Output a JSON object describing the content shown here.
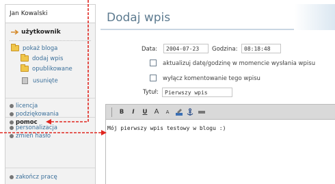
{
  "sidebar": {
    "user_name": "Jan Kowalski",
    "user_section_title": "użytkownik",
    "tree": [
      {
        "label": "pokaż bloga",
        "icon": "folder-icon"
      },
      {
        "label": "dodaj wpis",
        "icon": "folder-icon"
      },
      {
        "label": "opublikowane",
        "icon": "folder-icon"
      },
      {
        "label": "usunięte",
        "icon": "trash-icon"
      }
    ],
    "links_group1": [
      "licencja",
      "podziękowania",
      "pomoc"
    ],
    "links_group2": [
      "personalizacja",
      "zmień hasło"
    ],
    "links_group3": [
      "zakończ pracę"
    ]
  },
  "main": {
    "title": "Dodaj wpis",
    "date_label": "Data:",
    "date_value": "2004-07-23",
    "time_label": "Godzina:",
    "time_value": "08:18:48",
    "check1_label": "aktualizuj datę/godzinę w momencie wysłania wpisu",
    "check2_label": "wyłącz komentowanie tego wpisu",
    "title_label": "Tytuł:",
    "title_value": "Pierwszy wpis",
    "toolbar": {
      "bold": "B",
      "italic": "I",
      "underline": "U",
      "font_size_up": "A",
      "font_size_down": "A"
    },
    "content": "Mój pierwszy wpis testowy w blogu :)"
  },
  "colors": {
    "annotation": "#e0261f",
    "heading": "#5c7a8f",
    "link": "#3a6f9a"
  }
}
